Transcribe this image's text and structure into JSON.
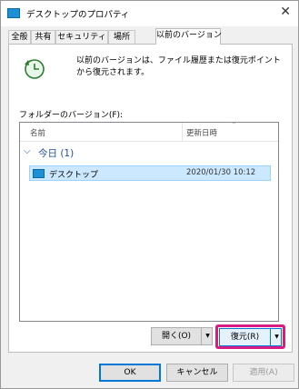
{
  "window": {
    "title": "デスクトップのプロパティ"
  },
  "tabs": [
    {
      "label": "全般"
    },
    {
      "label": "共有"
    },
    {
      "label": "セキュリティ"
    },
    {
      "label": "場所"
    },
    {
      "label": "以前のバージョン",
      "active": true
    }
  ],
  "panel": {
    "description": "以前のバージョンは、ファイル履歴または復元ポイントから復元されます。",
    "folder_versions_label": "フォルダーのバージョン(F):",
    "list": {
      "column_name": "名前",
      "column_modified": "更新日時",
      "group_label": "今日 (1)",
      "items": [
        {
          "name": "デスクトップ",
          "modified": "2020/01/30 10:12"
        }
      ]
    },
    "open_button": "開く(O)",
    "restore_button": "復元(R)"
  },
  "footer": {
    "ok": "OK",
    "cancel": "キャンセル",
    "apply": "適用(A)"
  },
  "colors": {
    "highlight": "#d91c84",
    "selection": "#cce8ff",
    "accent": "#1e90d6"
  },
  "icons": [
    "folder-icon",
    "clock-restore-icon",
    "close-icon",
    "chevron-down-icon",
    "dropdown-arrow-icon"
  ]
}
